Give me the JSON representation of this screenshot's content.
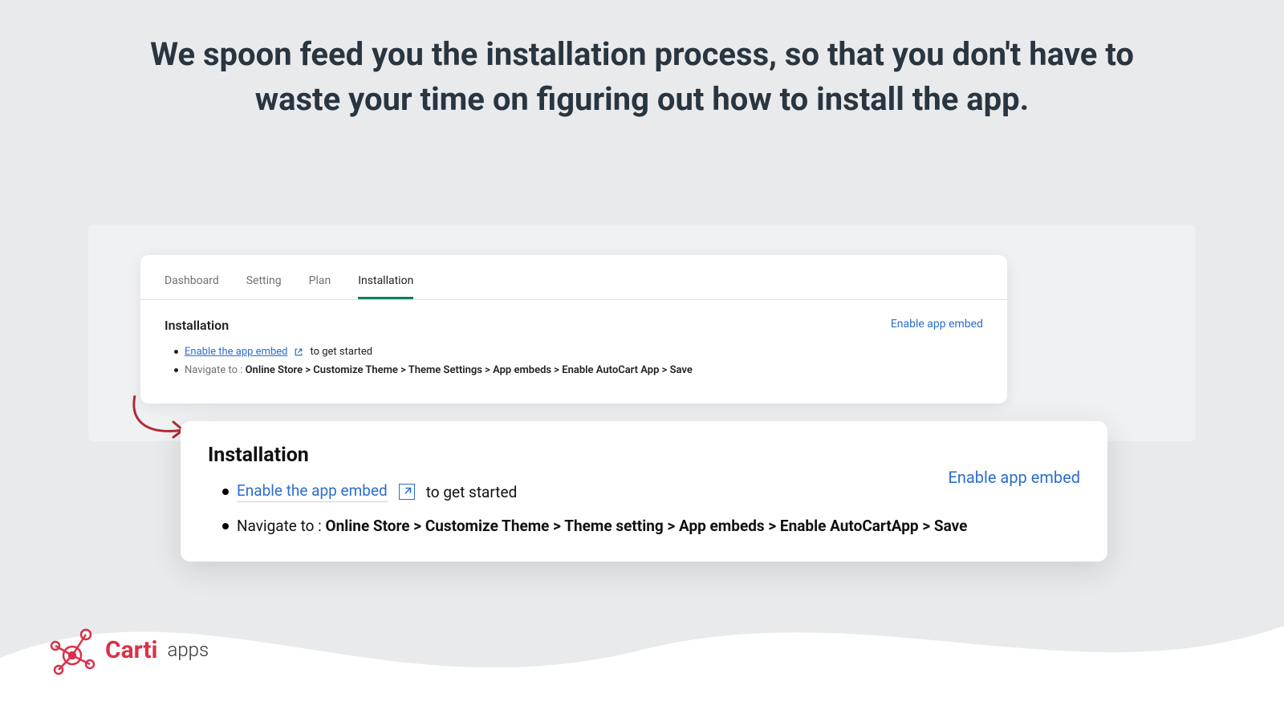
{
  "hero": "We spoon feed you the installation process, so that you don't have to waste your time on figuring out how to install the app.",
  "card1": {
    "tabs": [
      "Dashboard",
      "Setting",
      "Plan",
      "Installation"
    ],
    "active_tab_index": 3,
    "title": "Installation",
    "right_link": "Enable app embed",
    "bullet1_link": "Enable the app embed",
    "bullet1_suffix": "to get started",
    "bullet2_prefix": "Navigate to : ",
    "bullet2_path": "Online Store > Customize Theme > Theme Settings > App embeds > Enable AutoCart App > Save"
  },
  "card2": {
    "title": "Installation",
    "right_link": "Enable app embed",
    "bullet1_link": "Enable the app embed",
    "bullet1_suffix": "to get started",
    "bullet2_prefix": "Navigate to : ",
    "bullet2_path": "Online Store > Customize Theme > Theme setting > App embeds > Enable AutoCartApp > Save"
  },
  "logo": {
    "main": "Carti",
    "sub": "apps"
  },
  "colors": {
    "accent_green": "#008060",
    "link_blue": "#2c6ecb",
    "arrow_red": "#b02a37",
    "brand_red": "#d9324a"
  }
}
